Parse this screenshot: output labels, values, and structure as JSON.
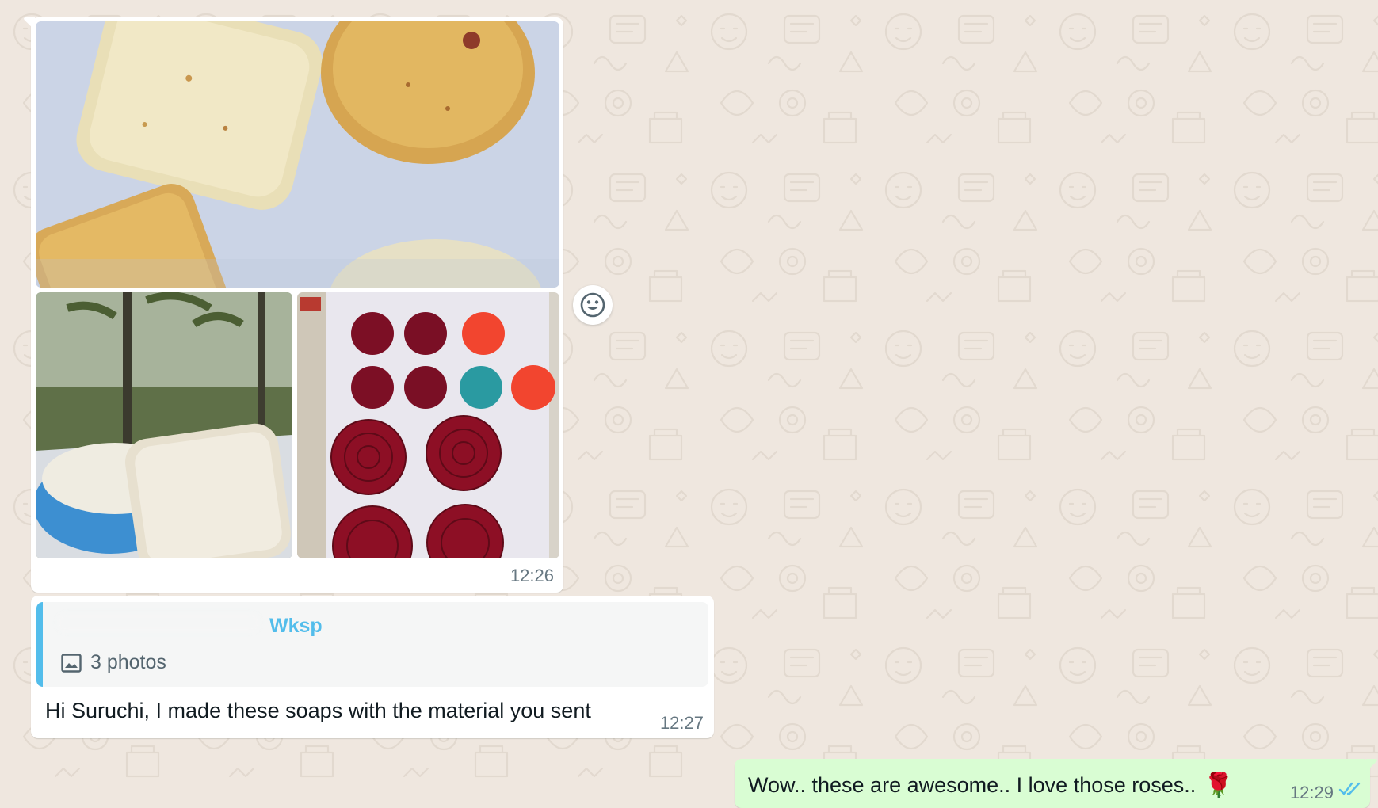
{
  "colors": {
    "wallpaper": "#efe7df",
    "incoming_bubble": "#ffffff",
    "outgoing_bubble": "#d9fdd3",
    "quote_accent": "#53bdeb",
    "read_ticks": "#53bdeb",
    "meta_text": "#667781"
  },
  "messages": {
    "photo_group": {
      "photo_count": 3,
      "time": "12:26"
    },
    "reply": {
      "quoted_author": "Wksp",
      "quoted_media_icon": "image-icon",
      "quoted_media_label": "3 photos",
      "text": "Hi Suruchi, I made these soaps with the material you sent",
      "time": "12:27"
    },
    "outgoing": {
      "text": "Wow.. these are awesome.. I love those roses..",
      "emoji": "🌹",
      "time": "12:29",
      "status_icon": "double-check-read-icon"
    }
  },
  "actions": {
    "react_icon": "smiley-icon"
  }
}
